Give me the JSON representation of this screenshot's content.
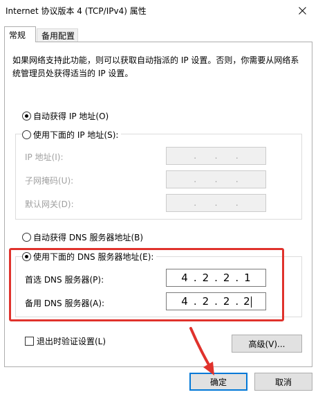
{
  "window": {
    "title": "Internet 协议版本 4 (TCP/IPv4) 属性",
    "close_icon": "close-icon"
  },
  "tabs": [
    {
      "label": "常规",
      "selected": true
    },
    {
      "label": "备用配置",
      "selected": false
    }
  ],
  "description": "如果网络支持此功能，则可以获取自动指派的 IP 设置。否则，你需要从网络系统管理员处获得适当的 IP 设置。",
  "ip_section": {
    "auto_label": "自动获得 IP 地址(O)",
    "auto_checked": true,
    "manual_label": "使用下面的 IP 地址(S):",
    "manual_checked": false,
    "fields": [
      {
        "label": "IP 地址(I):",
        "value": [
          "",
          "",
          "",
          ""
        ]
      },
      {
        "label": "子网掩码(U):",
        "value": [
          "",
          "",
          "",
          ""
        ]
      },
      {
        "label": "默认网关(D):",
        "value": [
          "",
          "",
          "",
          ""
        ]
      }
    ]
  },
  "dns_section": {
    "auto_label": "自动获得 DNS 服务器地址(B)",
    "auto_checked": false,
    "manual_label": "使用下面的 DNS 服务器地址(E):",
    "manual_checked": true,
    "preferred_label": "首选 DNS 服务器(P):",
    "preferred_value": [
      "4",
      "2",
      "2",
      "1"
    ],
    "alternate_label": "备用 DNS 服务器(A):",
    "alternate_value": [
      "4",
      "2",
      "2",
      "2"
    ]
  },
  "validate_label": "退出时验证设置(L)",
  "validate_checked": false,
  "buttons": {
    "advanced": "高级(V)...",
    "ok": "确定",
    "cancel": "取消"
  },
  "annotation_color": "#e0322c"
}
